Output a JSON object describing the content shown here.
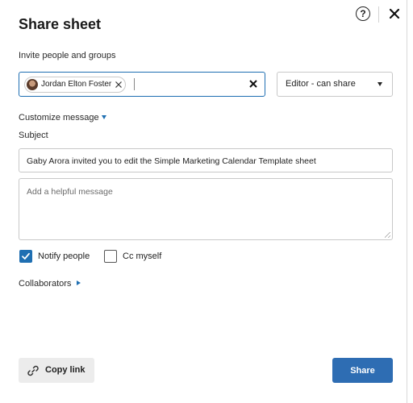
{
  "dialog": {
    "title": "Share sheet",
    "help_icon": "help-circle-icon",
    "close_icon": "close-icon"
  },
  "invite": {
    "label": "Invite people and groups",
    "chips": [
      {
        "name": "Jordan Elton Foster",
        "avatar": "avatar"
      }
    ],
    "clear_icon": "clear-x-icon"
  },
  "permission": {
    "selected": "Editor - can share",
    "caret_icon": "caret-down-icon"
  },
  "customize": {
    "label": "Customize message",
    "caret_icon": "caret-down-icon"
  },
  "subject": {
    "label": "Subject",
    "value": "Gaby Arora invited you to edit the Simple Marketing Calendar Template sheet"
  },
  "message": {
    "placeholder": "Add a helpful message",
    "value": ""
  },
  "options": {
    "notify_label": "Notify people",
    "notify_checked": true,
    "cc_label": "Cc myself",
    "cc_checked": false
  },
  "collaborators": {
    "label": "Collaborators",
    "caret_icon": "caret-right-icon"
  },
  "footer": {
    "copy_link_label": "Copy link",
    "copy_link_icon": "link-icon",
    "share_label": "Share"
  },
  "colors": {
    "accent": "#1f6fb2",
    "primary_button": "#2e6db3",
    "secondary_button": "#ececec"
  }
}
